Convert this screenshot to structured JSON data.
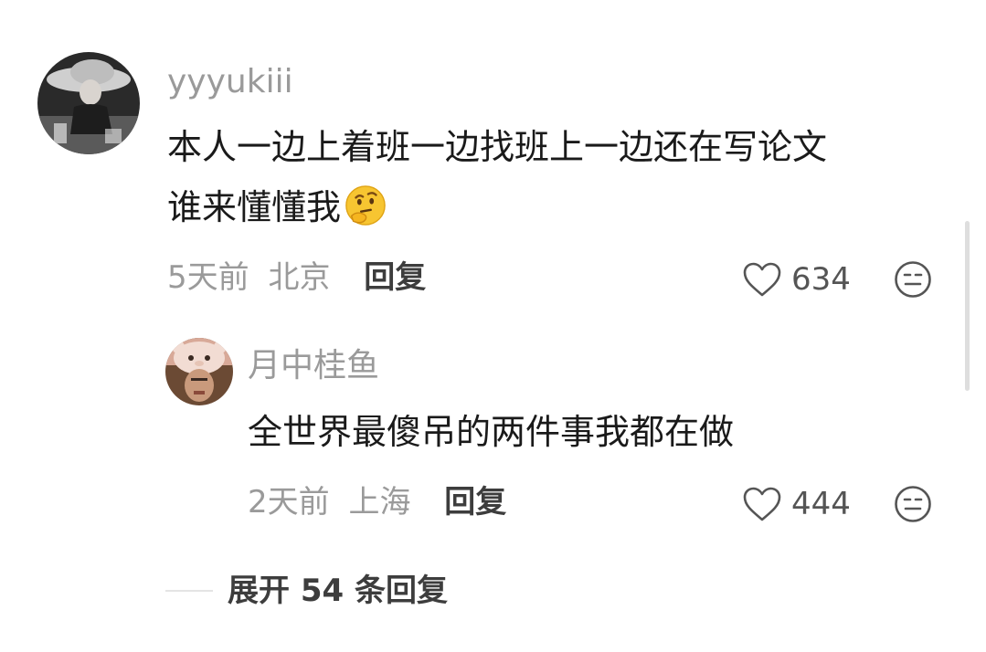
{
  "comment": {
    "username": "yyyukiii",
    "text_line1": "本人一边上着班一边找班上一边还在写论文",
    "text_line2": "谁来懂懂我",
    "emoji_icon": "thinking-face-emoji",
    "time": "5天前",
    "location": "北京",
    "reply_label": "回复",
    "like_count": "634"
  },
  "reply": {
    "username": "月中桂鱼",
    "text": "全世界最傻吊的两件事我都在做",
    "time": "2天前",
    "location": "上海",
    "reply_label": "回复",
    "like_count": "444"
  },
  "expand": {
    "label": "展开 54 条回复"
  },
  "colors": {
    "meta_gray": "#9a9a9a",
    "text_dark": "#1a1a1a",
    "action_dark": "#3d3d3d"
  }
}
